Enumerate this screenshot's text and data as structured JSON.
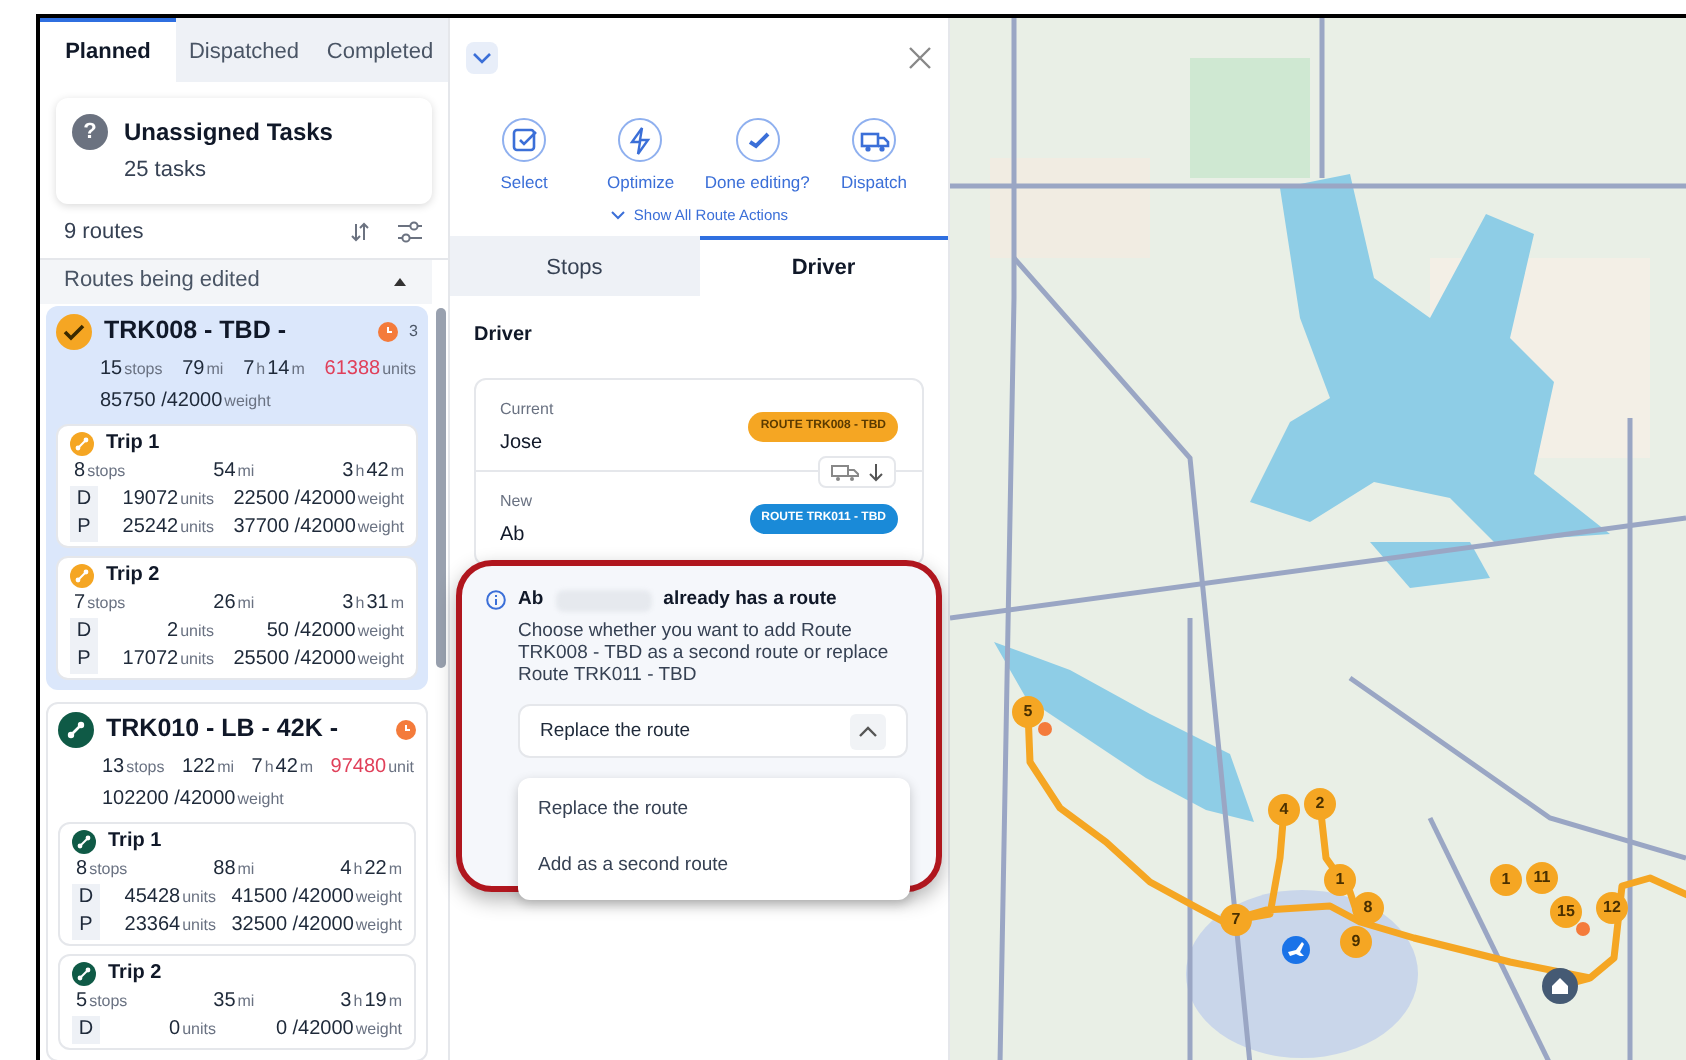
{
  "tabs": [
    {
      "label": "Planned",
      "selected": true
    },
    {
      "label": "Dispatched",
      "selected": false
    },
    {
      "label": "Completed",
      "selected": false
    }
  ],
  "unassigned": {
    "icon": "?",
    "title": "Unassigned Tasks",
    "count": "25 tasks"
  },
  "routes_count": "9 routes",
  "group": {
    "label": "Routes being edited",
    "expanded": true
  },
  "routes": [
    {
      "name": "TRK008 - TBD -",
      "kind": "editing",
      "selected": true,
      "badge": "3",
      "over_capacity": true,
      "stops": "15",
      "stops_unit": "stops",
      "miles": "79",
      "miles_unit": "mi",
      "hours": "7",
      "hours_unit": "h",
      "minutes": "14",
      "minutes_unit": "m",
      "units": "61388",
      "units_unit": "units",
      "weight": "85750 /42000",
      "weight_unit": "weight",
      "trips": [
        {
          "name": "Trip 1",
          "stops": "8",
          "stops_unit": "stops",
          "miles": "54",
          "miles_unit": "mi",
          "hours": "3",
          "hours_unit": "h",
          "minutes": "42",
          "minutes_unit": "m",
          "rows": [
            {
              "code": "D",
              "units": "19072",
              "units_unit": "units",
              "weight": "22500 /42000",
              "weight_unit": "weight"
            },
            {
              "code": "P",
              "units": "25242",
              "units_unit": "units",
              "weight": "37700 /42000",
              "weight_unit": "weight"
            }
          ]
        },
        {
          "name": "Trip 2",
          "stops": "7",
          "stops_unit": "stops",
          "miles": "26",
          "miles_unit": "mi",
          "hours": "3",
          "hours_unit": "h",
          "minutes": "31",
          "minutes_unit": "m",
          "rows": [
            {
              "code": "D",
              "units": "2",
              "units_unit": "units",
              "weight": "50 /42000",
              "weight_unit": "weight"
            },
            {
              "code": "P",
              "units": "17072",
              "units_unit": "units",
              "weight": "25500 /42000",
              "weight_unit": "weight"
            }
          ]
        }
      ]
    },
    {
      "name": "TRK010 - LB - 42K -",
      "kind": "planned",
      "selected": false,
      "over_capacity": true,
      "stops": "13",
      "stops_unit": "stops",
      "miles": "122",
      "miles_unit": "mi",
      "hours": "7",
      "hours_unit": "h",
      "minutes": "42",
      "minutes_unit": "m",
      "units": "97480",
      "units_unit": "unit",
      "weight": "102200 /42000",
      "weight_unit": "weight",
      "trips": [
        {
          "name": "Trip 1",
          "stops": "8",
          "stops_unit": "stops",
          "miles": "88",
          "miles_unit": "mi",
          "hours": "4",
          "hours_unit": "h",
          "minutes": "22",
          "minutes_unit": "m",
          "rows": [
            {
              "code": "D",
              "units": "45428",
              "units_unit": "units",
              "weight": "41500 /42000",
              "weight_unit": "weight"
            },
            {
              "code": "P",
              "units": "23364",
              "units_unit": "units",
              "weight": "32500 /42000",
              "weight_unit": "weight"
            }
          ]
        },
        {
          "name": "Trip 2",
          "stops": "5",
          "stops_unit": "stops",
          "miles": "35",
          "miles_unit": "mi",
          "hours": "3",
          "hours_unit": "h",
          "minutes": "19",
          "minutes_unit": "m",
          "rows": [
            {
              "code": "D",
              "units": "0",
              "units_unit": "units",
              "weight": "0 /42000",
              "weight_unit": "weight"
            }
          ]
        }
      ]
    }
  ],
  "actions": [
    {
      "kind": "select",
      "label": "Select"
    },
    {
      "kind": "optimize",
      "label": "Optimize"
    },
    {
      "kind": "done",
      "label": "Done editing?"
    },
    {
      "kind": "dispatch",
      "label": "Dispatch"
    }
  ],
  "show_all_actions": "Show All Route Actions",
  "detail_tabs": [
    {
      "label": "Stops",
      "selected": false
    },
    {
      "label": "Driver",
      "selected": true
    }
  ],
  "driver": {
    "heading": "Driver",
    "current": {
      "label": "Current",
      "name": "Jose",
      "route": "ROUTE TRK008 - TBD"
    },
    "new": {
      "label": "New",
      "name": "Ab",
      "route": "ROUTE TRK011 - TBD"
    }
  },
  "conflict": {
    "name": "Ab",
    "title": "already has a route",
    "message": "Choose whether you want to add Route TRK008 - TBD as a second route or replace Route TRK011 - TBD",
    "value": "Replace the route",
    "expanded": true,
    "options": [
      "Replace the route",
      "Add as a second route"
    ]
  },
  "map_markers": [
    {
      "label": "5",
      "alert": true
    },
    {
      "label": "4",
      "alert": false
    },
    {
      "label": "2",
      "alert": false
    },
    {
      "label": "1",
      "alert": false
    },
    {
      "label": "8",
      "alert": false
    },
    {
      "label": "9",
      "alert": false
    },
    {
      "label": "7",
      "alert": false
    },
    {
      "label": "1",
      "alert": false
    },
    {
      "label": "11",
      "alert": false
    },
    {
      "label": "15",
      "alert": true
    },
    {
      "label": "12",
      "alert": false
    }
  ]
}
